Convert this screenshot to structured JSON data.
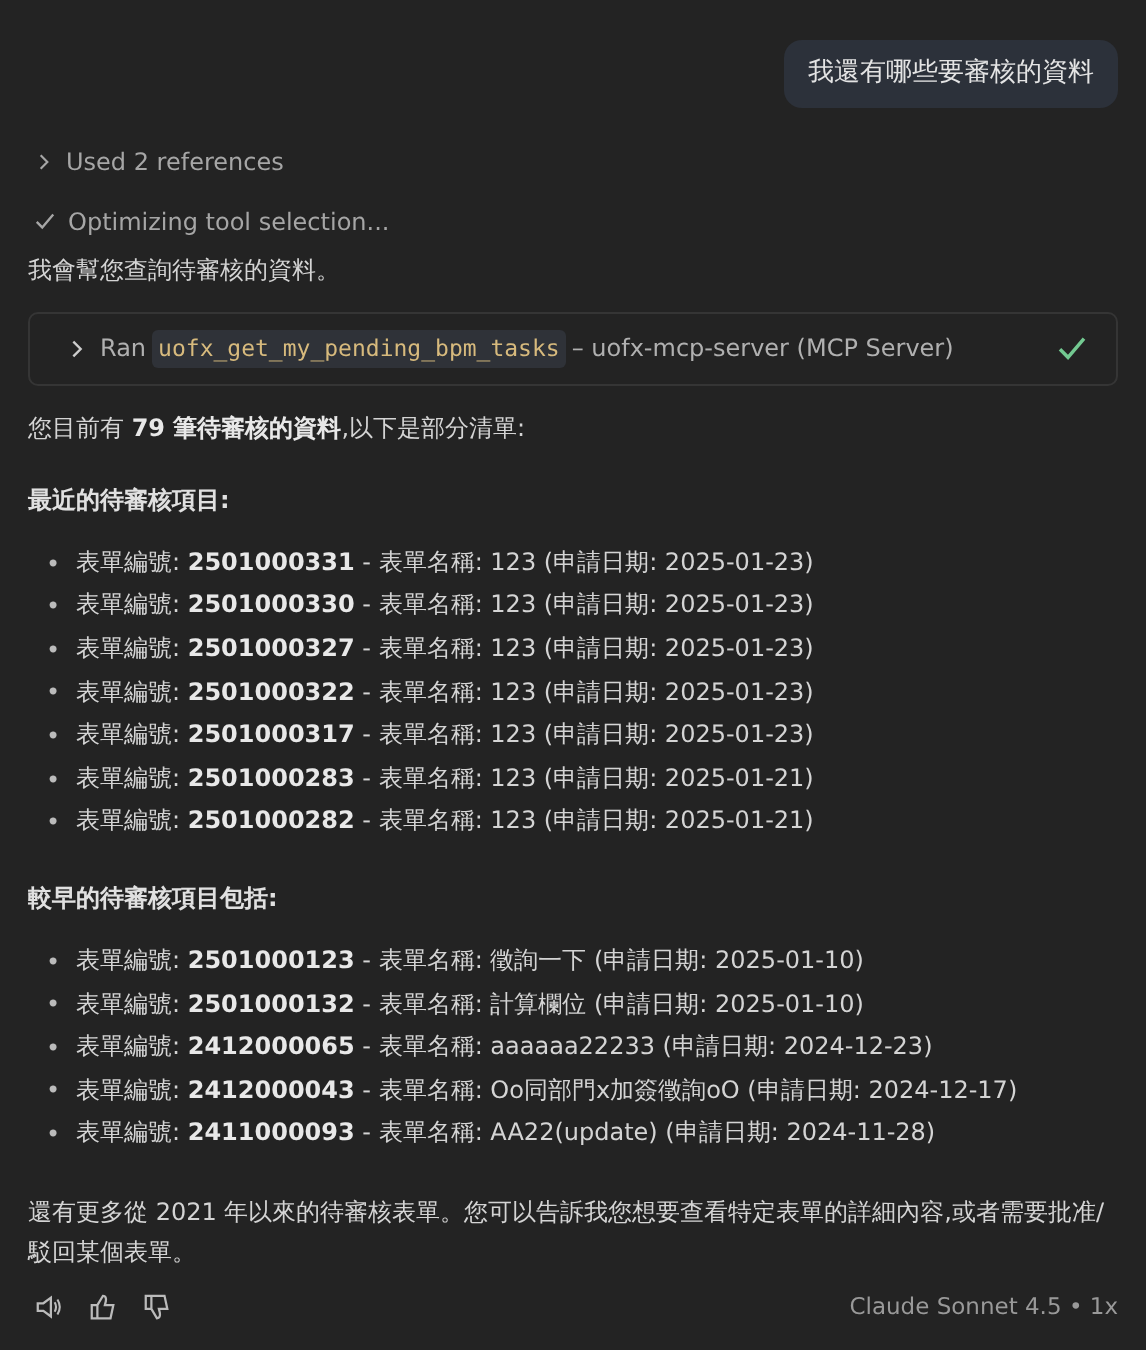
{
  "user_message": "我還有哪些要審核的資料",
  "steps": [
    {
      "kind": "collapsible",
      "label": "Used 2 references",
      "expanded": false
    },
    {
      "kind": "done",
      "label": "Optimizing tool selection..."
    }
  ],
  "intro": "我會幫您查詢待審核的資料。",
  "tool_call": {
    "label": "Ran",
    "tool": "uofx_get_my_pending_bpm_tasks",
    "server": "– uofx-mcp-server (MCP Server)",
    "expanded": false,
    "done": true
  },
  "summary": "您目前有 **79 筆待審核的資料**,以下是部分清單:",
  "sections": [
    {
      "heading": "最近的待審核項目:",
      "bullet": "•",
      "items": [
        "表單編號: **2501000331** - 表單名稱: 123 (申請日期: 2025-01-23)",
        "表單編號: **2501000330** - 表單名稱: 123 (申請日期: 2025-01-23)",
        "表單編號: **2501000327** - 表單名稱: 123 (申請日期: 2025-01-23)",
        "表單編號: **2501000322** - 表單名稱: 123 (申請日期: 2025-01-23)",
        "表單編號: **2501000317** - 表單名稱: 123 (申請日期: 2025-01-23)",
        "表單編號: **2501000283** - 表單名稱: 123 (申請日期: 2025-01-21)",
        "表單編號: **2501000282** - 表單名稱: 123 (申請日期: 2025-01-21)"
      ]
    },
    {
      "heading": "較早的待審核項目包括:",
      "bullet": "•",
      "items": [
        "表單編號: **2501000123** - 表單名稱: 徵詢一下 (申請日期: 2025-01-10)",
        "表單編號: **2501000132** - 表單名稱: 計算欄位 (申請日期: 2025-01-10)",
        "表單編號: **2412000065** - 表單名稱: aaaaaa22233 (申請日期: 2024-12-23)",
        "表單編號: **2412000043** - 表單名稱: Oo同部門x加簽徵詢oO (申請日期: 2024-12-17)",
        "表單編號: **2411000093** - 表單名稱: AA22(update) (申請日期: 2024-11-28)"
      ]
    }
  ],
  "closing": "還有更多從 2021 年以來的待審核表單。您可以告訴我您想要查看特定表單的詳細內容,或者需要批准/駁回某個表單。",
  "footer": {
    "model": "Claude Sonnet 4.5 • 1x"
  }
}
